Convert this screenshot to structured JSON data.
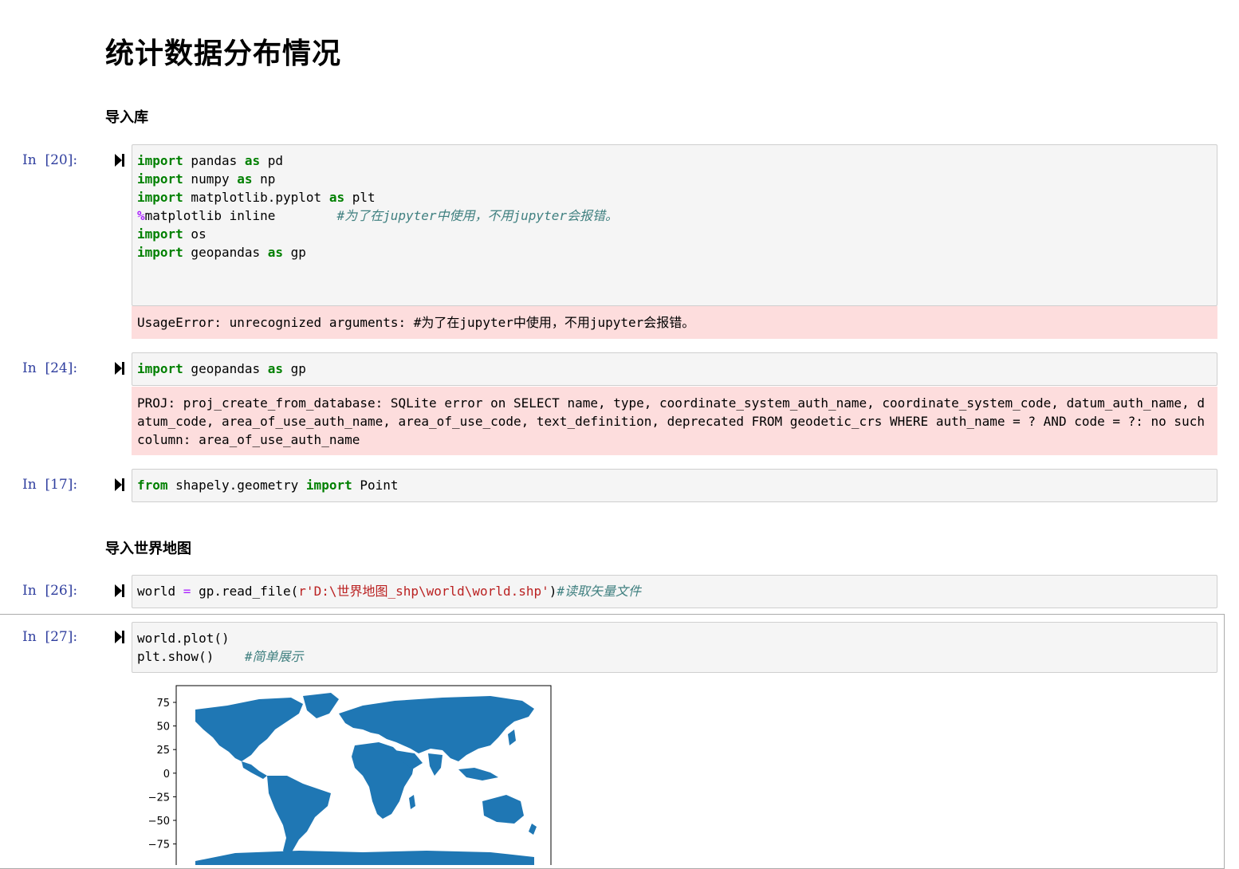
{
  "title": "统计数据分布情况",
  "section1": "导入库",
  "section2": "导入世界地图",
  "cells": [
    {
      "prompt": "In  [20]:",
      "lines": [
        [
          [
            "kw",
            "import"
          ],
          [
            "t",
            " pandas "
          ],
          [
            "kw",
            "as"
          ],
          [
            "t",
            " pd"
          ]
        ],
        [
          [
            "kw",
            "import"
          ],
          [
            "t",
            " numpy "
          ],
          [
            "kw",
            "as"
          ],
          [
            "t",
            " np"
          ]
        ],
        [
          [
            "kw",
            "import"
          ],
          [
            "t",
            " matplotlib.pyplot "
          ],
          [
            "kw",
            "as"
          ],
          [
            "t",
            " plt"
          ]
        ],
        [
          [
            "mg",
            "%"
          ],
          [
            "t",
            "matplotlib inline        "
          ],
          [
            "cm",
            "#为了在jupyter中使用，不用jupyter会报错。"
          ]
        ],
        [
          [
            "kw",
            "import"
          ],
          [
            "t",
            " os"
          ]
        ],
        [
          [
            "kw",
            "import"
          ],
          [
            "t",
            " geopandas "
          ],
          [
            "kw",
            "as"
          ],
          [
            "t",
            " gp"
          ]
        ]
      ],
      "error": "UsageError: unrecognized arguments: #为了在jupyter中使用，不用jupyter会报错。"
    },
    {
      "prompt": "In  [24]:",
      "lines": [
        [
          [
            "kw",
            "import"
          ],
          [
            "t",
            " geopandas "
          ],
          [
            "kw",
            "as"
          ],
          [
            "t",
            " gp"
          ]
        ]
      ],
      "error": "PROJ: proj_create_from_database: SQLite error on SELECT name, type, coordinate_system_auth_name, coordinate_system_code, datum_auth_name, datum_code, area_of_use_auth_name, area_of_use_code, text_definition, deprecated FROM geodetic_crs WHERE auth_name = ? AND code = ?: no such column: area_of_use_auth_name"
    },
    {
      "prompt": "In  [17]:",
      "lines": [
        [
          [
            "kw",
            "from"
          ],
          [
            "t",
            " shapely.geometry "
          ],
          [
            "kw",
            "import"
          ],
          [
            "t",
            " Point"
          ]
        ]
      ]
    },
    {
      "prompt": "In  [26]:",
      "lines": [
        [
          [
            "t",
            "world "
          ],
          [
            "op",
            "="
          ],
          [
            "t",
            " gp.read_file("
          ],
          [
            "st",
            "r'D:\\世界地图_shp\\world\\world.shp'"
          ],
          [
            "t",
            ")"
          ],
          [
            "cm",
            "#读取矢量文件"
          ]
        ]
      ]
    },
    {
      "prompt": "In  [27]:",
      "lines": [
        [
          [
            "t",
            "world.plot()"
          ]
        ],
        [
          [
            "t",
            "plt.show()    "
          ],
          [
            "cm",
            "#简单展示"
          ]
        ]
      ]
    }
  ],
  "plot": {
    "yticks": [
      "75",
      "50",
      "25",
      "0",
      "−25",
      "−50",
      "−75"
    ],
    "fill": "#1f77b4"
  }
}
